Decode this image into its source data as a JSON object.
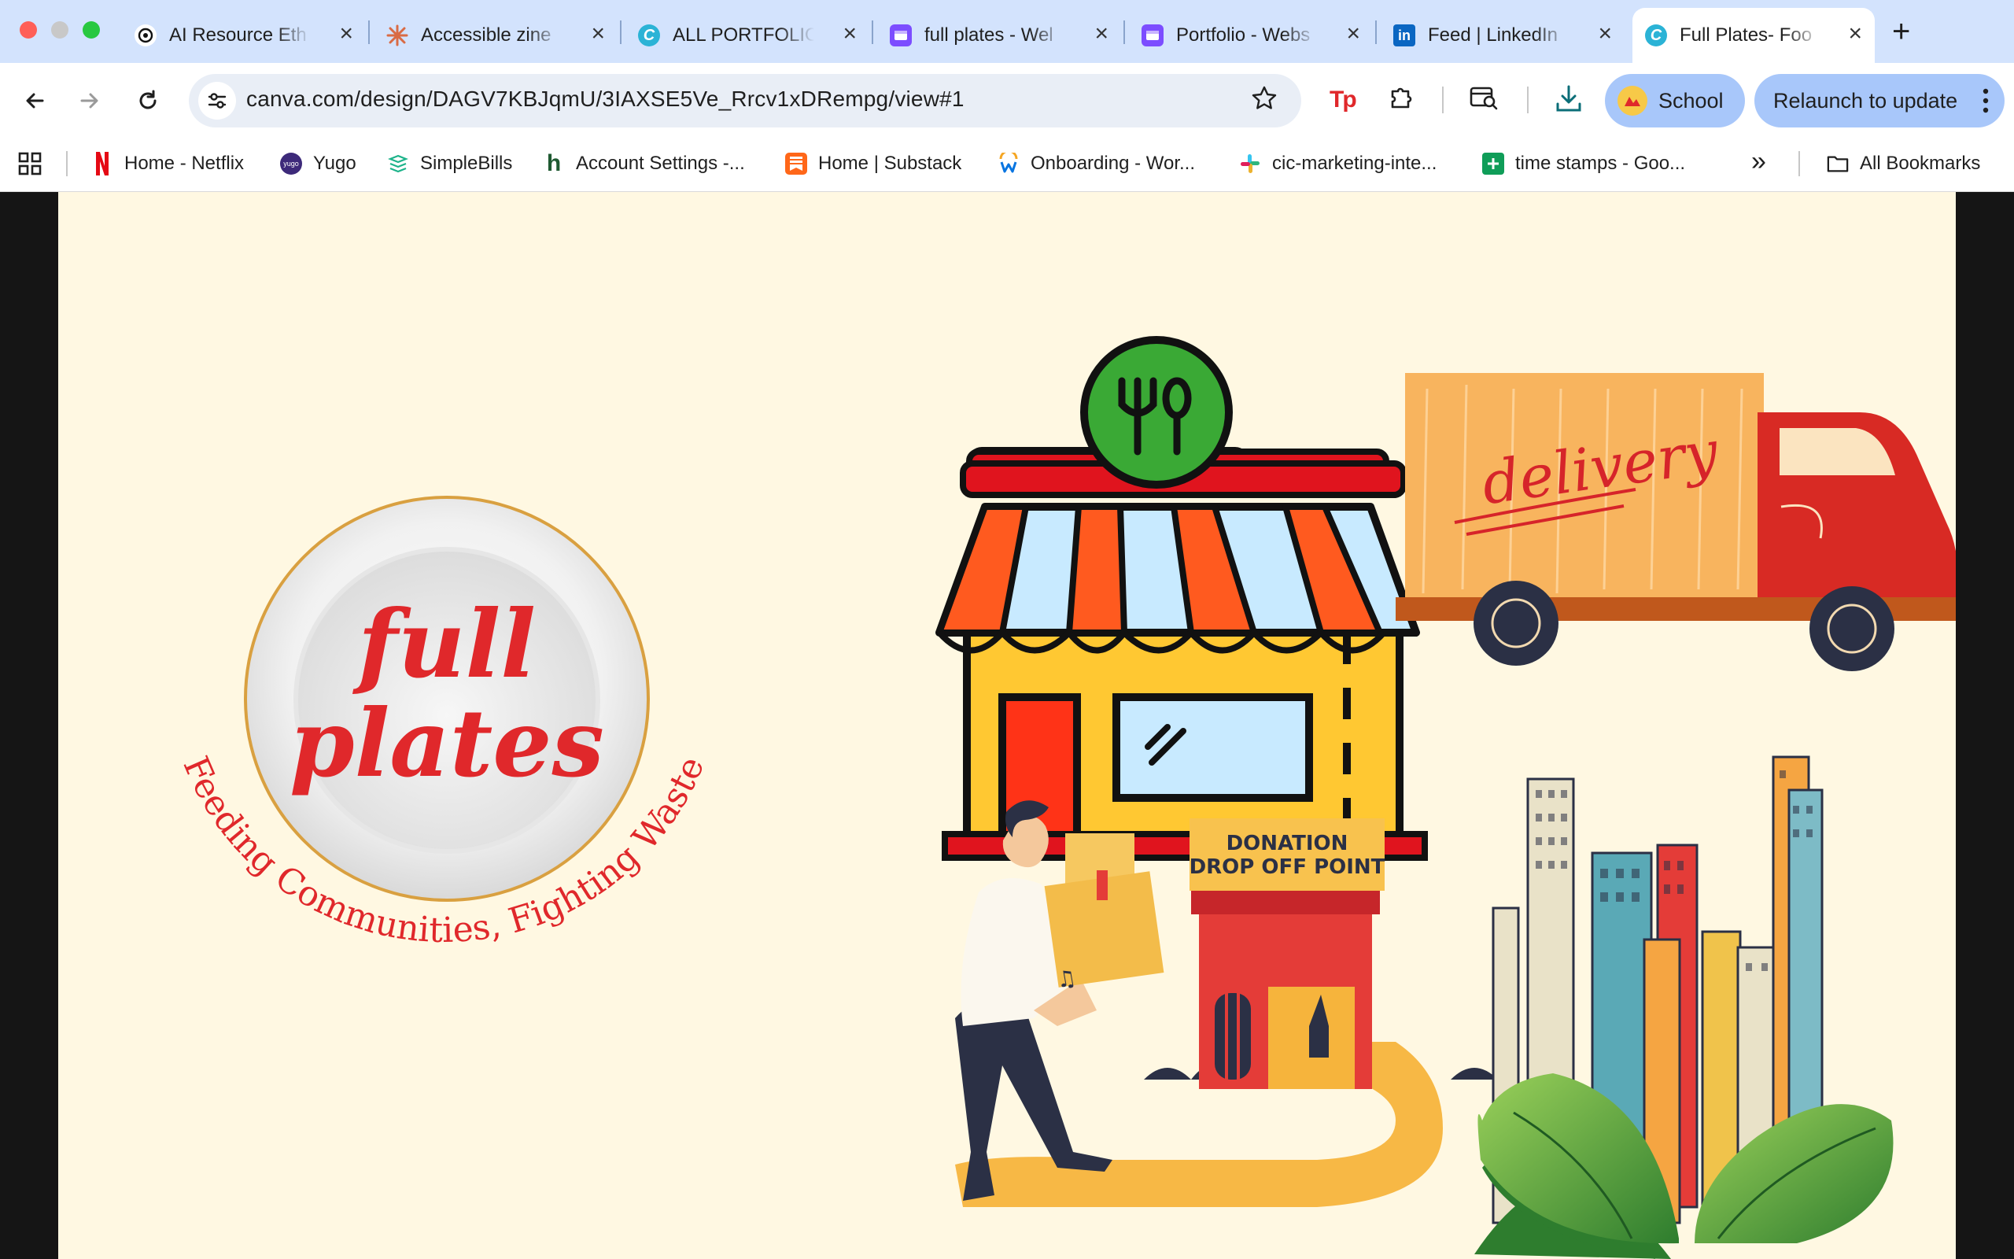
{
  "browser": {
    "tabs": [
      {
        "title": "AI Resource Eth",
        "active": false
      },
      {
        "title": "Accessible zine",
        "active": false
      },
      {
        "title": "ALL PORTFOLIO",
        "active": false
      },
      {
        "title": "full plates - Wel",
        "active": false
      },
      {
        "title": "Portfolio - Webs",
        "active": false
      },
      {
        "title": "Feed | LinkedIn",
        "active": false
      },
      {
        "title": "Full Plates- Foo",
        "active": true
      }
    ],
    "new_tab": "+",
    "url": "canva.com/design/DAGV7KBJqmU/3IAXSE5Ve_Rrcv1xDRempg/view#1",
    "profile_label": "School",
    "relaunch_label": "Relaunch to update",
    "bookmarks": [
      {
        "label": "Home - Netflix",
        "icon": "netflix-icon"
      },
      {
        "label": "Yugo",
        "icon": "yugo-icon"
      },
      {
        "label": "SimpleBills",
        "icon": "simplebills-icon"
      },
      {
        "label": "Account Settings -...",
        "icon": "houzz-icon"
      },
      {
        "label": "Home | Substack",
        "icon": "substack-icon"
      },
      {
        "label": "Onboarding - Wor...",
        "icon": "workday-icon"
      },
      {
        "label": "cic-marketing-inte...",
        "icon": "slack-icon"
      },
      {
        "label": "time stamps - Goo...",
        "icon": "sheets-icon"
      }
    ],
    "overflow": "»",
    "all_bookmarks": "All Bookmarks"
  },
  "design": {
    "logo_line1": "full",
    "logo_line2": "plates",
    "tagline": "Feeding Communities, Fighting Waste",
    "truck_label": "delivery",
    "donation_sign_line1": "DONATION",
    "donation_sign_line2": "DROP OFF POINT"
  },
  "colors": {
    "brand_red": "#e0282b",
    "canvas_bg": "#fff8e2",
    "gold_rim": "#d9a040",
    "tab_bar": "#d3e3fd",
    "pill_blue": "#a8c7fa"
  }
}
